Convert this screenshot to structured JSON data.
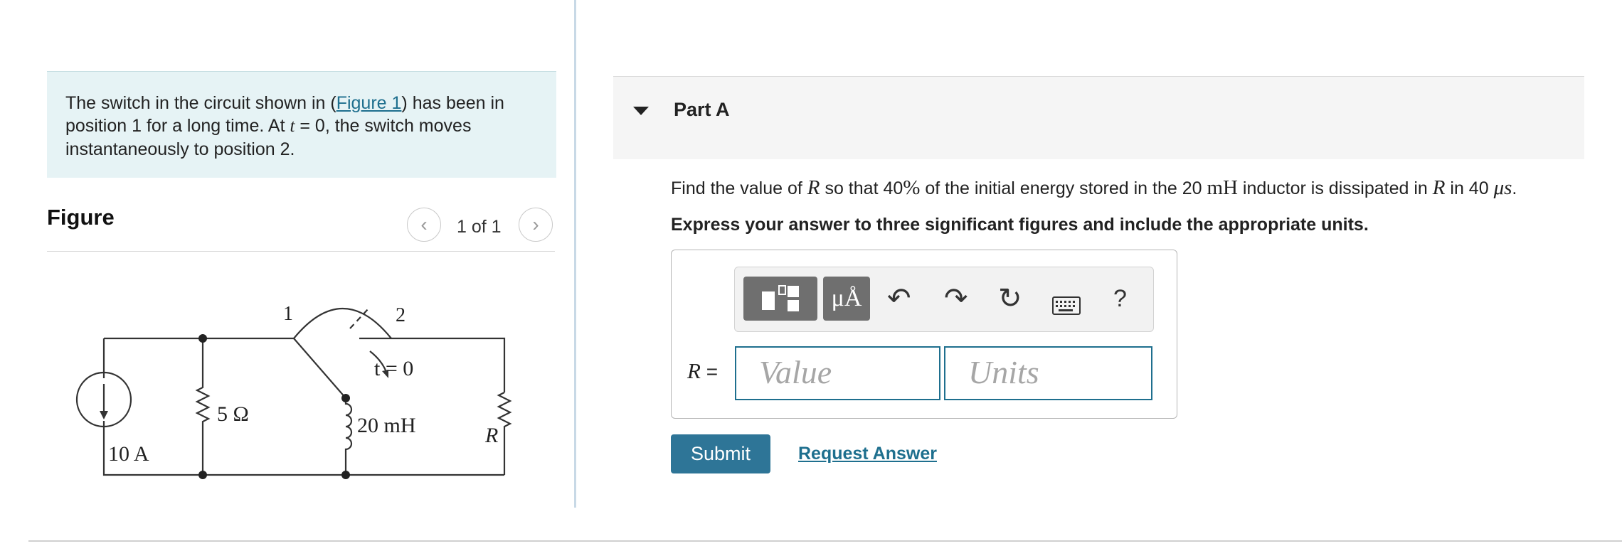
{
  "problem": {
    "text_before": "The switch in the circuit shown in (",
    "figure_link": "Figure 1",
    "text_after": ") has been in position 1 for a long time. At ",
    "t_symbol": "t",
    "text_end": " = 0, the switch moves instantaneously to position 2."
  },
  "figure": {
    "heading": "Figure",
    "pager": "1 of 1",
    "prev_icon": "chevron-left-icon",
    "next_icon": "chevron-right-icon",
    "circuit_labels": {
      "pos1": "1",
      "pos2": "2",
      "switch_time": "t = 0",
      "resistor": "5 Ω",
      "inductor": "20 mH",
      "load": "R",
      "source": "10 A"
    }
  },
  "part": {
    "title": "Part A",
    "question": {
      "q1": "Find the value of ",
      "R": "R",
      "q2": " so that 40",
      "pct": "%",
      "q3": " of the initial energy stored in the 20 ",
      "mH": "mH",
      "q4": " inductor is dissipated in ",
      "q5": " in 40 ",
      "us": "μs",
      "q6": "."
    },
    "instruction": "Express your answer to three significant figures and include the appropriate units.",
    "toolbar": {
      "units_label": "μÅ",
      "help": "?",
      "icons": [
        "templates-icon",
        "units-icon",
        "undo-icon",
        "redo-icon",
        "reset-icon",
        "keyboard-icon",
        "help-icon"
      ]
    },
    "answer": {
      "label": "R =",
      "value_placeholder": "Value",
      "units_placeholder": "Units"
    },
    "submit": "Submit",
    "request": "Request Answer"
  },
  "colors": {
    "accent": "#2e7597",
    "link": "#1e6f8e",
    "intro_bg": "#e6f3f5",
    "part_bg": "#f5f5f5"
  }
}
